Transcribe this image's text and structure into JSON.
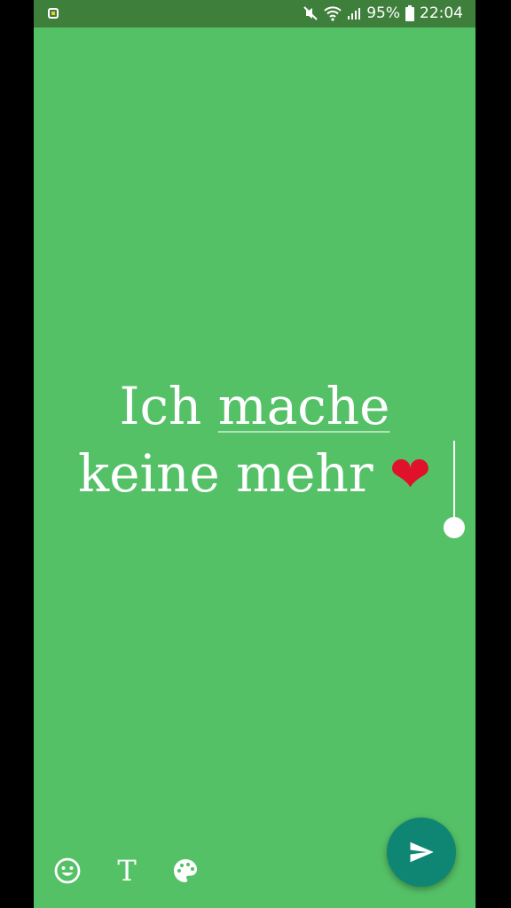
{
  "statusbar": {
    "battery": "95%",
    "time": "22:04",
    "icons": [
      "notification-icon",
      "mute-icon",
      "wifi-icon",
      "signal-icon",
      "battery-icon"
    ]
  },
  "editor": {
    "line1_word1": "Ich ",
    "line1_word2": "mache",
    "line2_text": "keine mehr ",
    "emoji": "❤"
  },
  "toolbar": {
    "icons": [
      "emoji-icon",
      "text-style-icon",
      "palette-icon"
    ],
    "text_style_glyph": "T"
  },
  "send": {
    "icon": "send-icon"
  },
  "colors": {
    "background": "#55C167",
    "statusbar": "#3F7F3C",
    "fab": "#0F8574",
    "text": "#FFFFFF"
  }
}
